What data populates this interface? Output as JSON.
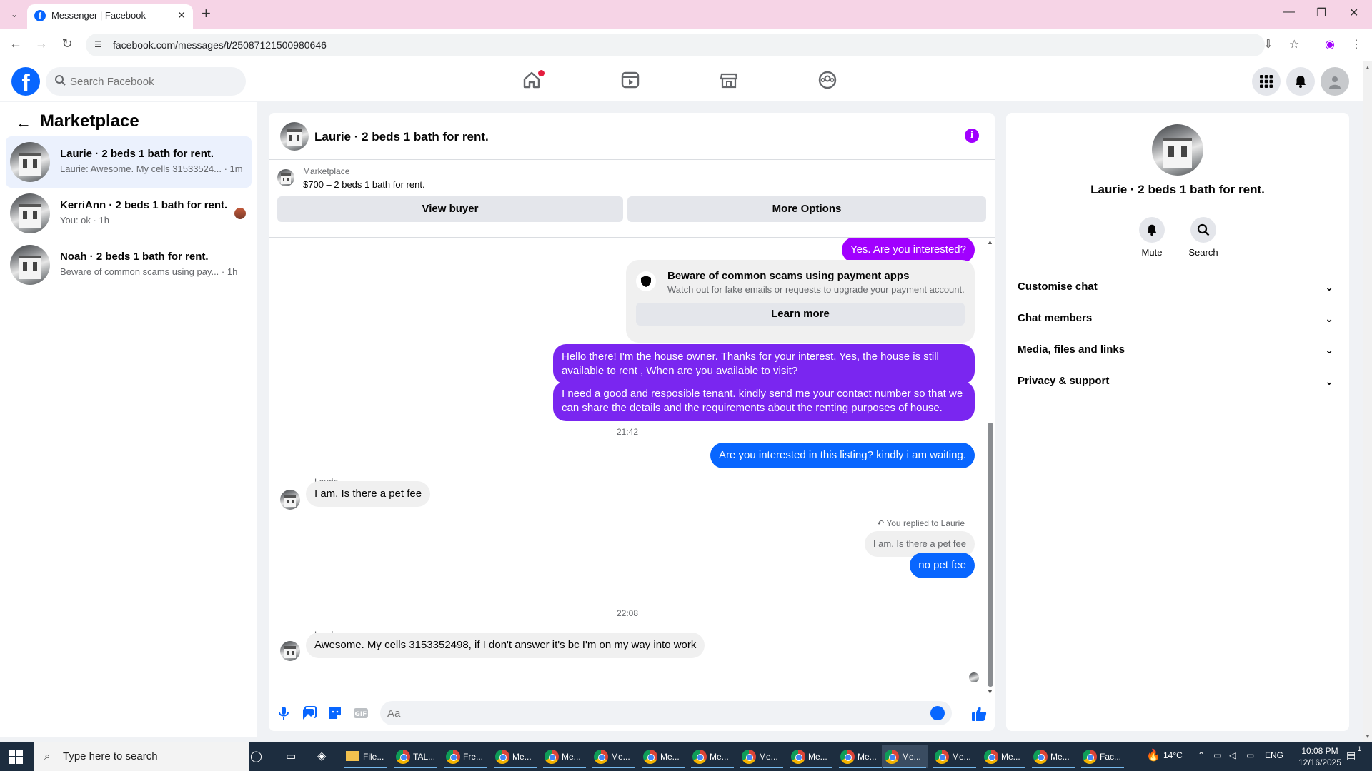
{
  "browser": {
    "tab_title": "Messenger | Facebook",
    "url": "facebook.com/messages/t/25087121500980646"
  },
  "fb": {
    "logo": "f",
    "search_placeholder": "Search Facebook",
    "nav_icons": [
      "home-icon",
      "video-icon",
      "marketplace-icon",
      "groups-icon"
    ],
    "right_icons": [
      "menu-grid-icon",
      "bell-icon",
      "avatar"
    ]
  },
  "left": {
    "title": "Marketplace",
    "conversations": [
      {
        "name": "Laurie · 2 beds 1 bath for rent.",
        "snippet": "Laurie: Awesome. My cells 31533524...",
        "time": "· 1m"
      },
      {
        "name": "KerriAnn · 2 beds 1 bath for rent.",
        "snippet": "You: ok",
        "time": "· 1h"
      },
      {
        "name": "Noah · 2 beds 1 bath for rent.",
        "snippet": "Beware of common scams using pay...",
        "time": "· 1h"
      }
    ]
  },
  "chat": {
    "title": "Laurie · 2 beds 1 bath for rent.",
    "info_label": "i",
    "marketplace_label": "Marketplace",
    "listing": "$700 – 2 beds 1 bath for rent.",
    "view_buyer": "View buyer",
    "more_options": "More Options",
    "messages": {
      "m1": "Yes. Are you interested?",
      "scam_title": "Beware of common scams using payment apps",
      "scam_desc": "Watch out for fake emails or requests to upgrade your payment account.",
      "learn_more": "Learn more",
      "m2": "Hello there! I'm the house owner. Thanks for your interest, Yes, the house is still available to rent , When are you available to visit?",
      "m3": "I need a good and resposible tenant.  kindly send me your contact number so that we can share the details and the requirements about the renting purposes of house.",
      "ts1": "21:42",
      "m4": "Are you interested in this listing? kindly i am waiting.",
      "sender1": "Laurie",
      "m5": "I am. Is there a pet fee",
      "replied_label": "You replied to Laurie",
      "replied_quote": "I am. Is there a pet fee",
      "m6": "no pet fee",
      "ts2": "22:08",
      "sender2": "Laurie",
      "m7": "Awesome. My cells 3153352498, if I don't answer it's bc I'm on my way into work"
    },
    "composer_placeholder": "Aa"
  },
  "right": {
    "name": "Laurie · 2 beds 1 bath for rent.",
    "mute": "Mute",
    "search": "Search",
    "sections": [
      "Customise chat",
      "Chat members",
      "Media, files and links",
      "Privacy & support"
    ]
  },
  "taskbar": {
    "search_placeholder": "Type here to search",
    "apps": [
      "File...",
      "TAL...",
      "Fre...",
      "Me...",
      "Me...",
      "Me...",
      "Me...",
      "Me...",
      "Me...",
      "Me...",
      "Me...",
      "Me...",
      "Me...",
      "Me...",
      "Me...",
      "Fac..."
    ],
    "temperature": "14°C",
    "language": "ENG",
    "time": "10:08 PM",
    "date": "12/16/2025",
    "notification_count": "1"
  },
  "colors": {
    "accent_purple": "#a100ff",
    "fb_blue": "#0866ff",
    "tab_bar": "#f6d4e6"
  }
}
